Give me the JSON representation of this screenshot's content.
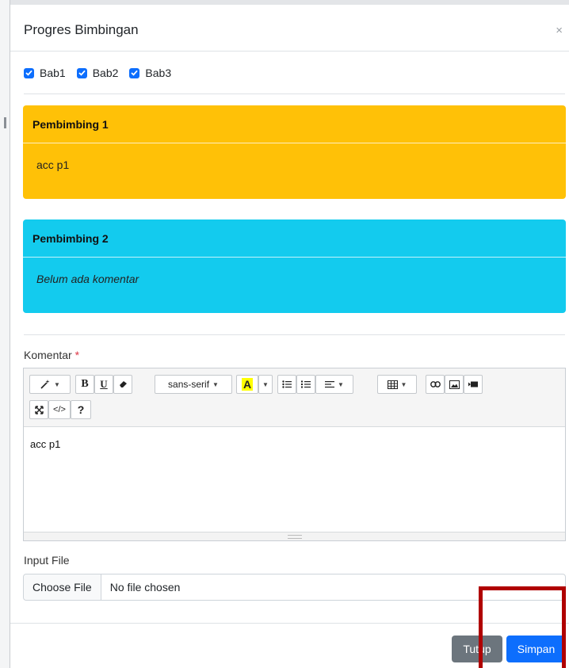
{
  "modal": {
    "title": "Progres Bimbingan",
    "close_symbol": "×"
  },
  "checkboxes": [
    {
      "label": "Bab1",
      "checked": true
    },
    {
      "label": "Bab2",
      "checked": true
    },
    {
      "label": "Bab3",
      "checked": true
    }
  ],
  "cards": [
    {
      "title": "Pembimbing 1",
      "body": "acc p1",
      "color": "#ffc107"
    },
    {
      "title": "Pembimbing 2",
      "body": "Belum ada komentar",
      "color": "#13cbee"
    }
  ],
  "comment": {
    "label": "Komentar",
    "required_mark": "*",
    "editor_content": "acc p1",
    "toolbar": {
      "font_name": "sans-serif",
      "bold": "B",
      "underline": "U",
      "code": "</>",
      "help": "?"
    }
  },
  "file": {
    "label": "Input File",
    "button": "Choose File",
    "status": "No file chosen"
  },
  "footer": {
    "close_label": "Tutup",
    "save_label": "Simpan"
  },
  "colors": {
    "primary": "#0d6efd",
    "secondary": "#6c757d",
    "warning": "#ffc107",
    "info": "#13cbee",
    "highlight": "#b00000"
  }
}
